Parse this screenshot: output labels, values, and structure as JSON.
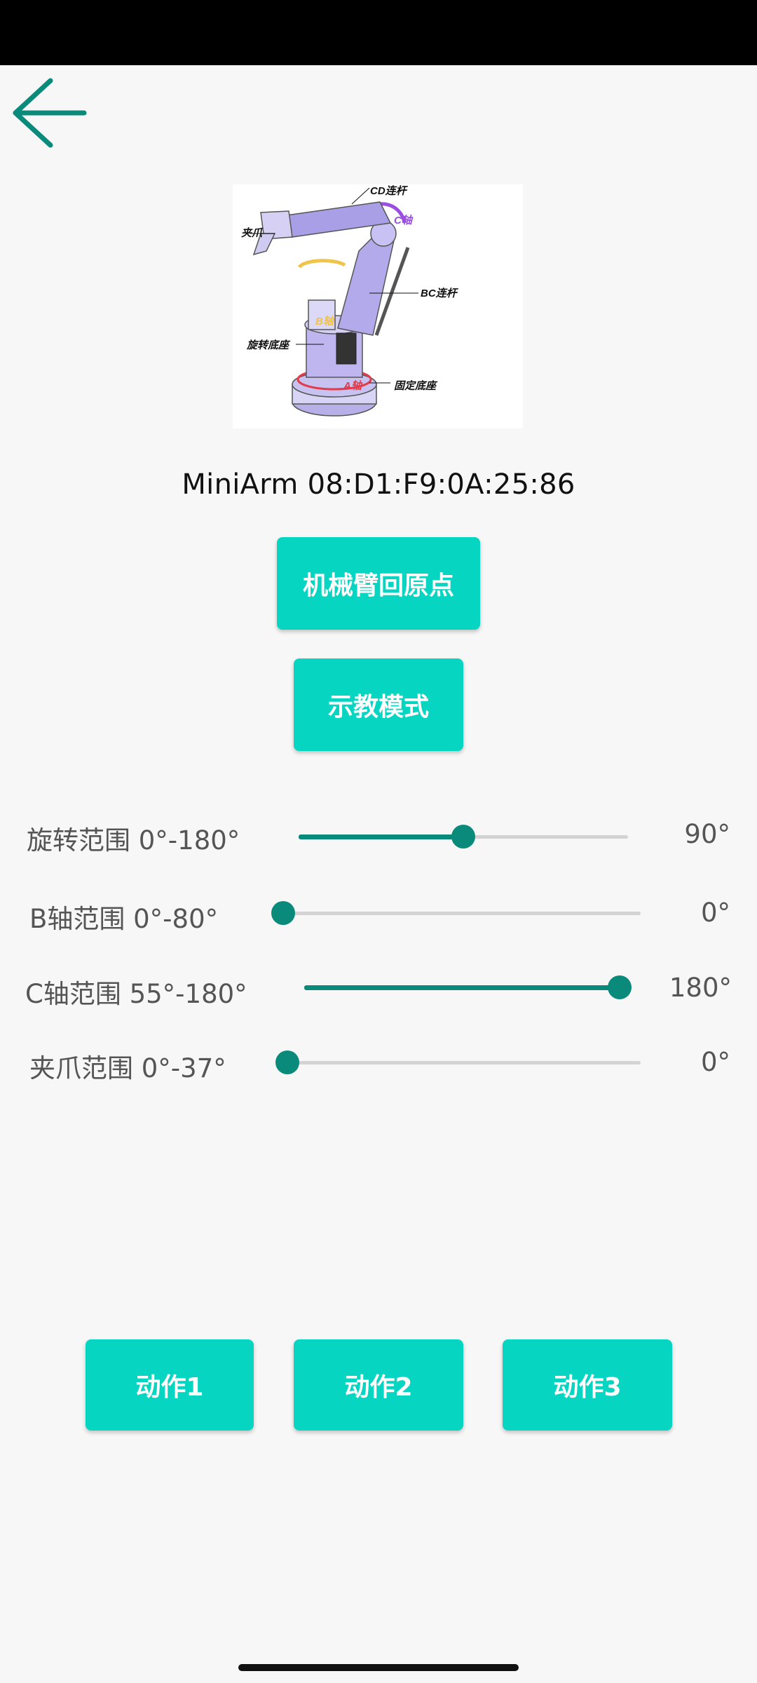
{
  "device": {
    "title": "MiniArm 08:D1:F9:0A:25:86"
  },
  "diagram": {
    "labels": {
      "gripper": "夹爪",
      "cd_link": "CD连杆",
      "c_axis": "C轴",
      "bc_link": "BC连杆",
      "b_axis": "B轴",
      "rotating_base": "旋转底座",
      "a_axis": "A轴",
      "fixed_base": "固定底座"
    }
  },
  "buttons": {
    "home": "机械臂回原点",
    "teach": "示教模式",
    "action1": "动作1",
    "action2": "动作2",
    "action3": "动作3"
  },
  "sliders": [
    {
      "label": "旋转范围 0°-180°",
      "value_text": "90°",
      "min": 0,
      "max": 180,
      "value": 90
    },
    {
      "label": "B轴范围 0°-80°",
      "value_text": "0°",
      "min": 0,
      "max": 80,
      "value": 0
    },
    {
      "label": "C轴范围 55°-180°",
      "value_text": "180°",
      "min": 55,
      "max": 180,
      "value": 180
    },
    {
      "label": "夹爪范围 0°-37°",
      "value_text": "0°",
      "min": 0,
      "max": 37,
      "value": 0
    }
  ],
  "colors": {
    "accent": "#06d6c1",
    "slider": "#0a8a7a",
    "back_arrow": "#0a8a7a"
  }
}
